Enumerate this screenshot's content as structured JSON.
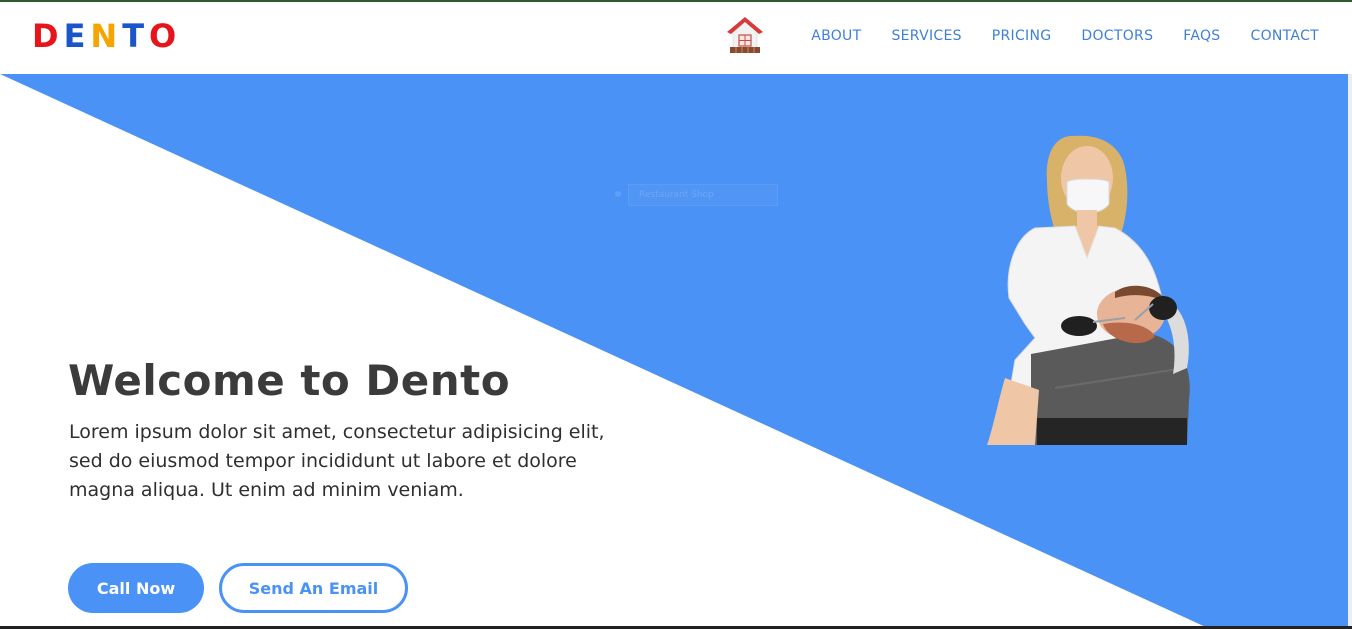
{
  "header": {
    "logo_letters": [
      {
        "char": "D",
        "color": "#e8141c"
      },
      {
        "char": "E",
        "color": "#1a56c9"
      },
      {
        "char": "N",
        "color": "#f5a400"
      },
      {
        "char": "T",
        "color": "#1a56c9"
      },
      {
        "char": "O",
        "color": "#e8141c"
      }
    ],
    "home_icon": "house-icon",
    "nav": [
      "ABOUT",
      "SERVICES",
      "PRICING",
      "DOCTORS",
      "FAQS",
      "CONTACT"
    ]
  },
  "hero": {
    "overlay_placeholder": "Restaurant Shop",
    "title": "Welcome to Dento",
    "text": "Lorem ipsum dolor sit amet, consectetur adipisicing elit, sed do eiusmod tempor incididunt ut labore et dolore magna aliqua. Ut enim ad minim veniam.",
    "call_button": "Call Now",
    "email_button": "Send An Email"
  },
  "colors": {
    "accent_blue": "#4a92f5",
    "nav_text": "#3f7fd8",
    "title_text": "#3b3b3b"
  }
}
